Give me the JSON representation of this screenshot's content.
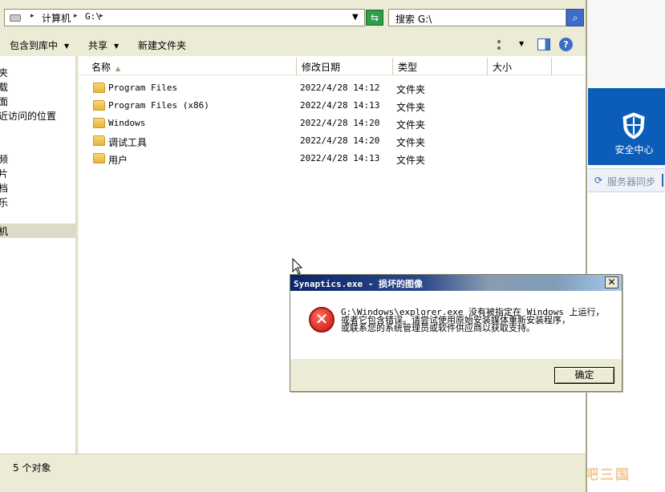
{
  "address": {
    "crumbs": [
      "计算机",
      "G:\\"
    ],
    "search_placeholder": "搜索 G:\\"
  },
  "toolbar": {
    "include_library": "包含到库中",
    "share": "共享",
    "new_folder": "新建文件夹"
  },
  "nav": {
    "items": [
      "夹",
      "载",
      "面",
      "近访问的位置",
      "频",
      "片",
      "档",
      "乐",
      "机"
    ]
  },
  "columns": {
    "name": "名称",
    "modified": "修改日期",
    "type": "类型",
    "size": "大小"
  },
  "files": [
    {
      "name": "Program Files",
      "modified": "2022/4/28 14:12",
      "type": "文件夹"
    },
    {
      "name": "Program Files (x86)",
      "modified": "2022/4/28 14:13",
      "type": "文件夹"
    },
    {
      "name": "Windows",
      "modified": "2022/4/28 14:20",
      "type": "文件夹"
    },
    {
      "name": "调试工具",
      "modified": "2022/4/28 14:20",
      "type": "文件夹"
    },
    {
      "name": "用户",
      "modified": "2022/4/28 14:13",
      "type": "文件夹"
    }
  ],
  "status": {
    "count": "5 个对象"
  },
  "dialog": {
    "title": "Synaptics.exe - 损坏的图像",
    "message_lines": [
      "G:\\Windows\\explorer.exe 没有被指定在 Windows 上运行，",
      "或者它包含错误。请尝试使用原始安装媒体重新安装程序，",
      "或联系您的系统管理员或软件供应商以获取支持。"
    ],
    "ok": "确定",
    "close": "✕"
  },
  "background_app": {
    "security_center": "安全中心",
    "server_sync": "服务器同步"
  },
  "watermark": "网吧三国",
  "colors": {
    "chrome": "#ecebd6",
    "accent_blue": "#0c5db8",
    "error_red": "#c3150f"
  }
}
